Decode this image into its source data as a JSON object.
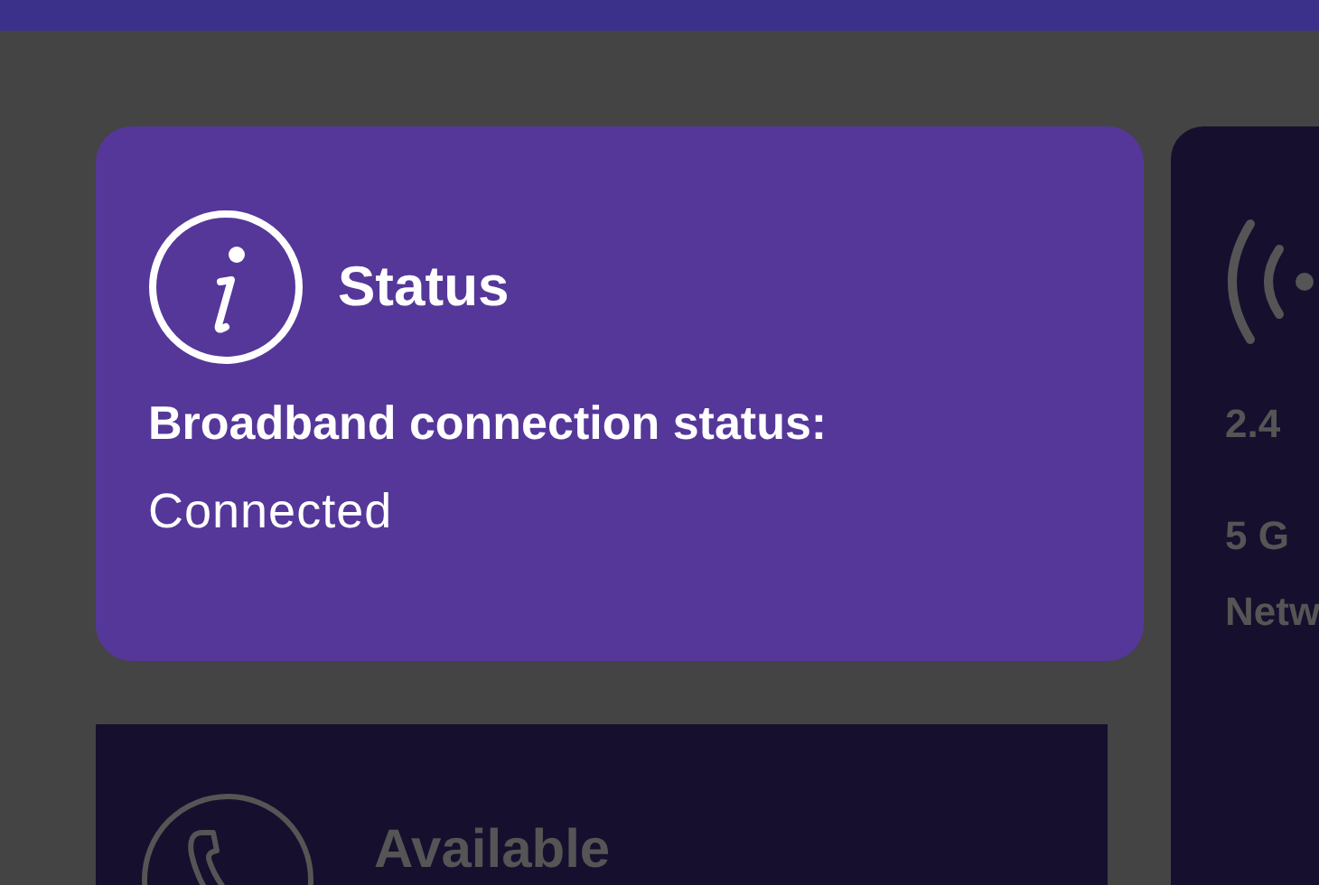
{
  "status_card": {
    "title": "Status",
    "label": "Broadband connection status:",
    "value": "Connected"
  },
  "wifi_card": {
    "lines": [
      "2.4",
      "5 G",
      "Netw"
    ]
  },
  "phone_card": {
    "title": "Available"
  }
}
